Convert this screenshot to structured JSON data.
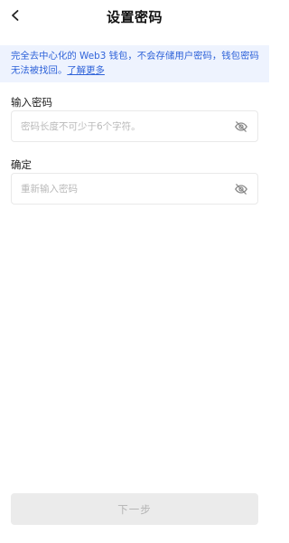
{
  "header": {
    "title": "设置密码",
    "back_icon": "chevron-left-icon"
  },
  "notice": {
    "text": "完全去中心化的 Web3 钱包，不会存储用户密码，钱包密码无法被找回。",
    "link_label": "了解更多",
    "background": "#eef3fe",
    "color": "#2f63d9"
  },
  "password_field": {
    "label": "输入密码",
    "placeholder": "密码长度不可少于6个字符。",
    "value": "",
    "icon": "eye-off-icon"
  },
  "confirm_field": {
    "label": "确定",
    "placeholder": "重新输入密码",
    "value": "",
    "icon": "eye-off-icon"
  },
  "footer": {
    "next_label": "下一步",
    "enabled": false
  }
}
